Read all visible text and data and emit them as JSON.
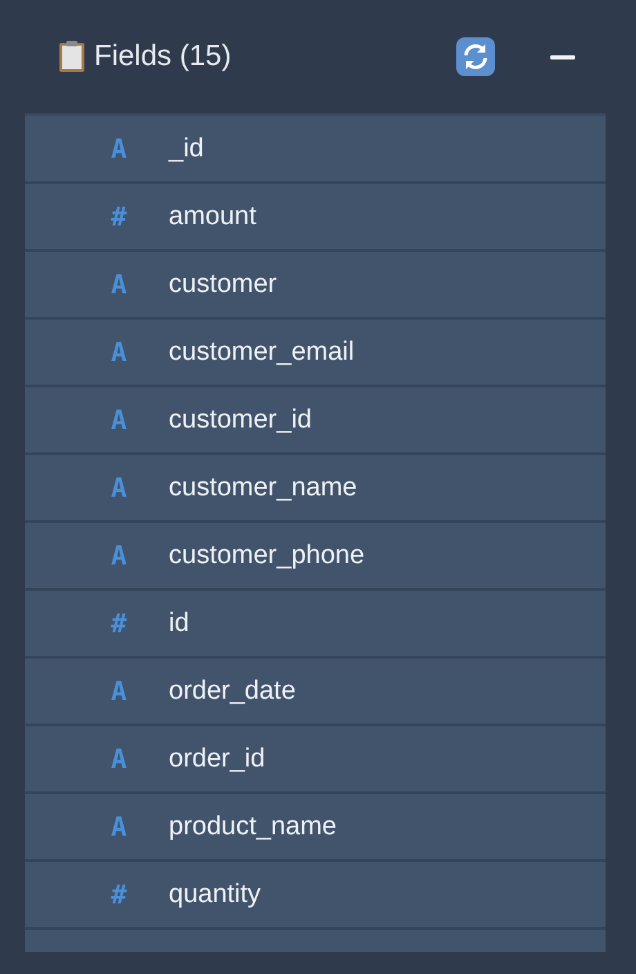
{
  "panel": {
    "title": "Fields (15)"
  },
  "fields": [
    {
      "symbol": "A",
      "name": "_id"
    },
    {
      "symbol": "#",
      "name": "amount"
    },
    {
      "symbol": "A",
      "name": "customer"
    },
    {
      "symbol": "A",
      "name": "customer_email"
    },
    {
      "symbol": "A",
      "name": "customer_id"
    },
    {
      "symbol": "A",
      "name": "customer_name"
    },
    {
      "symbol": "A",
      "name": "customer_phone"
    },
    {
      "symbol": "#",
      "name": "id"
    },
    {
      "symbol": "A",
      "name": "order_date"
    },
    {
      "symbol": "A",
      "name": "order_id"
    },
    {
      "symbol": "A",
      "name": "product_name"
    },
    {
      "symbol": "#",
      "name": "quantity"
    }
  ]
}
